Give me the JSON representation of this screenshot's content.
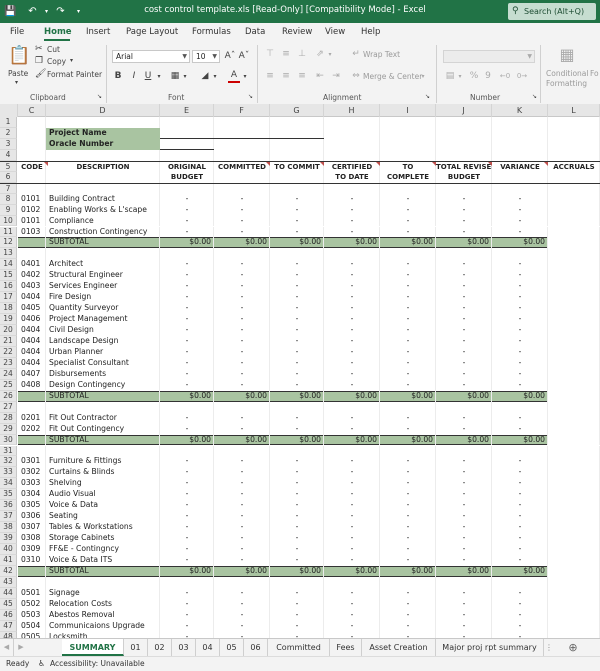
{
  "window": {
    "title": "cost control template.xls  [Read-Only]  [Compatibility Mode]  -  Excel",
    "search_placeholder": "Search (Alt+Q)"
  },
  "menu_tabs": [
    "File",
    "Home",
    "Insert",
    "Page Layout",
    "Formulas",
    "Data",
    "Review",
    "View",
    "Help"
  ],
  "active_tab": "Home",
  "ribbon": {
    "clipboard": {
      "paste": "Paste",
      "cut": "Cut",
      "copy": "Copy",
      "format_painter": "Format Painter",
      "label": "Clipboard"
    },
    "font": {
      "name": "Arial",
      "size": "10",
      "label": "Font"
    },
    "alignment": {
      "wrap": "Wrap Text",
      "merge": "Merge & Center",
      "label": "Alignment"
    },
    "number": {
      "label": "Number"
    },
    "styles": {
      "conditional": "Conditional",
      "formatting": "Formatting",
      "fo": "Fo"
    }
  },
  "columns": [
    "C",
    "D",
    "E",
    "F",
    "G",
    "H",
    "I",
    "J",
    "K",
    "L"
  ],
  "headers": {
    "code": "CODE",
    "description": "DESCRIPTION",
    "original": [
      "ORIGINAL",
      "BUDGET"
    ],
    "committed": "COMMITTED",
    "to_commit": "TO COMMIT",
    "certified": [
      "CERTIFIED",
      "TO DATE"
    ],
    "to_complete": [
      "TO",
      "COMPLETE"
    ],
    "total_revised": [
      "TOTAL REVISED",
      "BUDGET"
    ],
    "variance": "VARIANCE",
    "accruals": "ACCRUALS"
  },
  "project_name_label": "Project Name",
  "oracle_number_label": "Oracle Number",
  "subtotal_label": "SUBTOTAL",
  "zero_value": "$0.00",
  "dash": "-",
  "rows": [
    {
      "n": 8,
      "code": "0101",
      "desc": "Building Contract"
    },
    {
      "n": 9,
      "code": "0102",
      "desc": "Enabling Works & L'scape"
    },
    {
      "n": 10,
      "code": "0101",
      "desc": "Compliance"
    },
    {
      "n": 11,
      "code": "0103",
      "desc": "Construction Contingency"
    },
    {
      "n": 12,
      "type": "subtotal"
    },
    {
      "n": 13,
      "type": "blank"
    },
    {
      "n": 14,
      "code": "0401",
      "desc": "Architect"
    },
    {
      "n": 15,
      "code": "0402",
      "desc": "Structural Engineer"
    },
    {
      "n": 16,
      "code": "0403",
      "desc": "Services Engineer"
    },
    {
      "n": 17,
      "code": "0404",
      "desc": "Fire Design"
    },
    {
      "n": 18,
      "code": "0405",
      "desc": "Quantity Surveyor"
    },
    {
      "n": 19,
      "code": "0406",
      "desc": "Project Management"
    },
    {
      "n": 20,
      "code": "0404",
      "desc": "Civil Design"
    },
    {
      "n": 21,
      "code": "0404",
      "desc": "Landscape Design"
    },
    {
      "n": 22,
      "code": "0404",
      "desc": "Urban Planner"
    },
    {
      "n": 23,
      "code": "0404",
      "desc": "Specialist Consultant"
    },
    {
      "n": 24,
      "code": "0407",
      "desc": "Disbursements"
    },
    {
      "n": 25,
      "code": "0408",
      "desc": "Design Contingency"
    },
    {
      "n": 26,
      "type": "subtotal"
    },
    {
      "n": 27,
      "type": "blank"
    },
    {
      "n": 28,
      "code": "0201",
      "desc": "Fit Out Contractor"
    },
    {
      "n": 29,
      "code": "0202",
      "desc": "Fit Out Contingency"
    },
    {
      "n": 30,
      "type": "subtotal"
    },
    {
      "n": 31,
      "type": "blank"
    },
    {
      "n": 32,
      "code": "0301",
      "desc": "Furniture & Fittings"
    },
    {
      "n": 33,
      "code": "0302",
      "desc": "Curtains & Blinds"
    },
    {
      "n": 34,
      "code": "0303",
      "desc": "Shelving"
    },
    {
      "n": 35,
      "code": "0304",
      "desc": "Audio Visual"
    },
    {
      "n": 36,
      "code": "0305",
      "desc": "Voice & Data"
    },
    {
      "n": 37,
      "code": "0306",
      "desc": "Seating"
    },
    {
      "n": 38,
      "code": "0307",
      "desc": "Tables & Workstations"
    },
    {
      "n": 39,
      "code": "0308",
      "desc": "Storage Cabinets"
    },
    {
      "n": 40,
      "code": "0309",
      "desc": "FF&E - Contingncy"
    },
    {
      "n": 41,
      "code": "0310",
      "desc": "Voice & Data ITS"
    },
    {
      "n": 42,
      "type": "subtotal"
    },
    {
      "n": 43,
      "type": "blank"
    },
    {
      "n": 44,
      "code": "0501",
      "desc": "Signage"
    },
    {
      "n": 45,
      "code": "0502",
      "desc": "Relocation Costs"
    },
    {
      "n": 46,
      "code": "0503",
      "desc": "Abestos Removal"
    },
    {
      "n": 47,
      "code": "0504",
      "desc": "Communicaions Upgrade"
    },
    {
      "n": 48,
      "code": "0505",
      "desc": "Locksmith"
    }
  ],
  "sheet_tabs": [
    "SUMMARY",
    "01",
    "02",
    "03",
    "04",
    "05",
    "06",
    "Committed",
    "Fees",
    "Asset Creation",
    "Major proj rpt summary"
  ],
  "status": {
    "ready": "Ready",
    "accessibility": "Accessibility: Unavailable"
  },
  "colors": {
    "excel_green": "#217346",
    "subtotal_green": "#a9c4a1"
  }
}
